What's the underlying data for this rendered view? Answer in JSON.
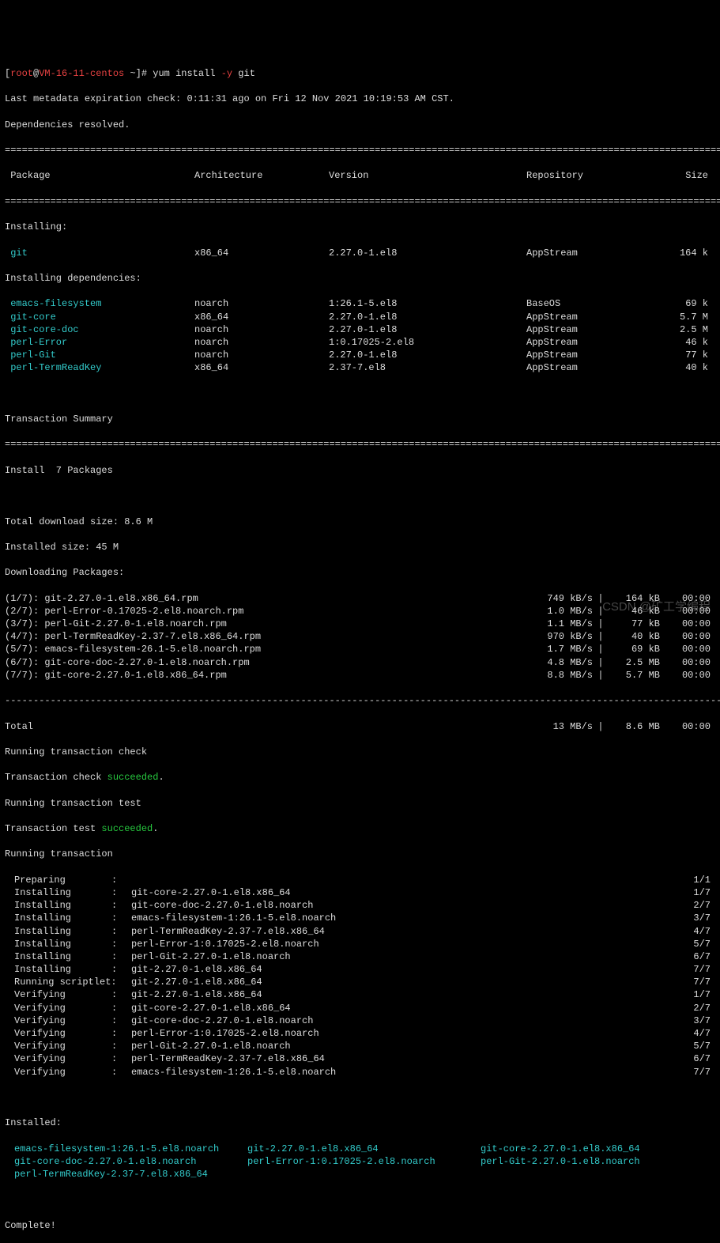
{
  "prompt": {
    "user": "root",
    "host": "VM-16-11-centos",
    "path": "~",
    "cmd_bin": "yum install",
    "cmd_flag": "-y",
    "cmd_args": "git"
  },
  "meta_line": "Last metadata expiration check: 0:11:31 ago on Fri 12 Nov 2021 10:19:53 AM CST.",
  "deps_line": "Dependencies resolved.",
  "sep_double": "=========================================================================================================================================",
  "sep_dash": "-----------------------------------------------------------------------------------------------------------------------------------------",
  "headers": {
    "pkg": " Package",
    "arch": "Architecture",
    "ver": "Version",
    "repo": "Repository",
    "size": "Size"
  },
  "installing_label": "Installing:",
  "installing": [
    {
      "pkg": " git",
      "arch": "x86_64",
      "ver": "2.27.0-1.el8",
      "repo": "AppStream",
      "size": "164 k"
    }
  ],
  "deps_label": "Installing dependencies:",
  "deps": [
    {
      "pkg": " emacs-filesystem",
      "arch": "noarch",
      "ver": "1:26.1-5.el8",
      "repo": "BaseOS",
      "size": "69 k"
    },
    {
      "pkg": " git-core",
      "arch": "x86_64",
      "ver": "2.27.0-1.el8",
      "repo": "AppStream",
      "size": "5.7 M"
    },
    {
      "pkg": " git-core-doc",
      "arch": "noarch",
      "ver": "2.27.0-1.el8",
      "repo": "AppStream",
      "size": "2.5 M"
    },
    {
      "pkg": " perl-Error",
      "arch": "noarch",
      "ver": "1:0.17025-2.el8",
      "repo": "AppStream",
      "size": "46 k"
    },
    {
      "pkg": " perl-Git",
      "arch": "noarch",
      "ver": "2.27.0-1.el8",
      "repo": "AppStream",
      "size": "77 k"
    },
    {
      "pkg": " perl-TermReadKey",
      "arch": "x86_64",
      "ver": "2.37-7.el8",
      "repo": "AppStream",
      "size": "40 k"
    }
  ],
  "txn_summary": "Transaction Summary",
  "install_count": "Install  7 Packages",
  "total_dl": "Total download size: 8.6 M",
  "inst_size": "Installed size: 45 M",
  "dl_label": "Downloading Packages:",
  "downloads": [
    {
      "l": "(1/7): git-2.27.0-1.el8.x86_64.rpm",
      "sp": "749 kB/s",
      "sz": "164 kB",
      "t": "00:00"
    },
    {
      "l": "(2/7): perl-Error-0.17025-2.el8.noarch.rpm",
      "sp": "1.0 MB/s",
      "sz": "46 kB",
      "t": "00:00"
    },
    {
      "l": "(3/7): perl-Git-2.27.0-1.el8.noarch.rpm",
      "sp": "1.1 MB/s",
      "sz": "77 kB",
      "t": "00:00"
    },
    {
      "l": "(4/7): perl-TermReadKey-2.37-7.el8.x86_64.rpm",
      "sp": "970 kB/s",
      "sz": "40 kB",
      "t": "00:00"
    },
    {
      "l": "(5/7): emacs-filesystem-26.1-5.el8.noarch.rpm",
      "sp": "1.7 MB/s",
      "sz": "69 kB",
      "t": "00:00"
    },
    {
      "l": "(6/7): git-core-doc-2.27.0-1.el8.noarch.rpm",
      "sp": "4.8 MB/s",
      "sz": "2.5 MB",
      "t": "00:00"
    },
    {
      "l": "(7/7): git-core-2.27.0-1.el8.x86_64.rpm",
      "sp": "8.8 MB/s",
      "sz": "5.7 MB",
      "t": "00:00"
    }
  ],
  "total_row": {
    "l": "Total",
    "sp": "13 MB/s",
    "sz": "8.6 MB",
    "t": "00:00"
  },
  "run_check": "Running transaction check",
  "check_ok_1": "Transaction check ",
  "check_ok_2": "succeeded",
  "run_test": "Running transaction test",
  "test_ok_1": "Transaction test ",
  "run_txn": "Running transaction",
  "steps": [
    {
      "a": "Preparing",
      "n": "",
      "c": "1/1"
    },
    {
      "a": "Installing",
      "n": "git-core-2.27.0-1.el8.x86_64",
      "c": "1/7"
    },
    {
      "a": "Installing",
      "n": "git-core-doc-2.27.0-1.el8.noarch",
      "c": "2/7"
    },
    {
      "a": "Installing",
      "n": "emacs-filesystem-1:26.1-5.el8.noarch",
      "c": "3/7"
    },
    {
      "a": "Installing",
      "n": "perl-TermReadKey-2.37-7.el8.x86_64",
      "c": "4/7"
    },
    {
      "a": "Installing",
      "n": "perl-Error-1:0.17025-2.el8.noarch",
      "c": "5/7"
    },
    {
      "a": "Installing",
      "n": "perl-Git-2.27.0-1.el8.noarch",
      "c": "6/7"
    },
    {
      "a": "Installing",
      "n": "git-2.27.0-1.el8.x86_64",
      "c": "7/7"
    },
    {
      "a": "Running scriptlet:",
      "n": "git-2.27.0-1.el8.x86_64",
      "c": "7/7"
    },
    {
      "a": "Verifying",
      "n": "git-2.27.0-1.el8.x86_64",
      "c": "1/7"
    },
    {
      "a": "Verifying",
      "n": "git-core-2.27.0-1.el8.x86_64",
      "c": "2/7"
    },
    {
      "a": "Verifying",
      "n": "git-core-doc-2.27.0-1.el8.noarch",
      "c": "3/7"
    },
    {
      "a": "Verifying",
      "n": "perl-Error-1:0.17025-2.el8.noarch",
      "c": "4/7"
    },
    {
      "a": "Verifying",
      "n": "perl-Git-2.27.0-1.el8.noarch",
      "c": "5/7"
    },
    {
      "a": "Verifying",
      "n": "perl-TermReadKey-2.37-7.el8.x86_64",
      "c": "6/7"
    },
    {
      "a": "Verifying",
      "n": "emacs-filesystem-1:26.1-5.el8.noarch",
      "c": "7/7"
    }
  ],
  "installed_label": "Installed:",
  "installed_rows": [
    [
      "emacs-filesystem-1:26.1-5.el8.noarch",
      "git-2.27.0-1.el8.x86_64",
      "git-core-2.27.0-1.el8.x86_64"
    ],
    [
      "git-core-doc-2.27.0-1.el8.noarch",
      "perl-Error-1:0.17025-2.el8.noarch",
      "perl-Git-2.27.0-1.el8.noarch"
    ],
    [
      "perl-TermReadKey-2.37-7.el8.x86_64",
      "",
      ""
    ]
  ],
  "complete": "Complete!",
  "watermark": "CSDN @矿工学编程",
  "dot": "."
}
